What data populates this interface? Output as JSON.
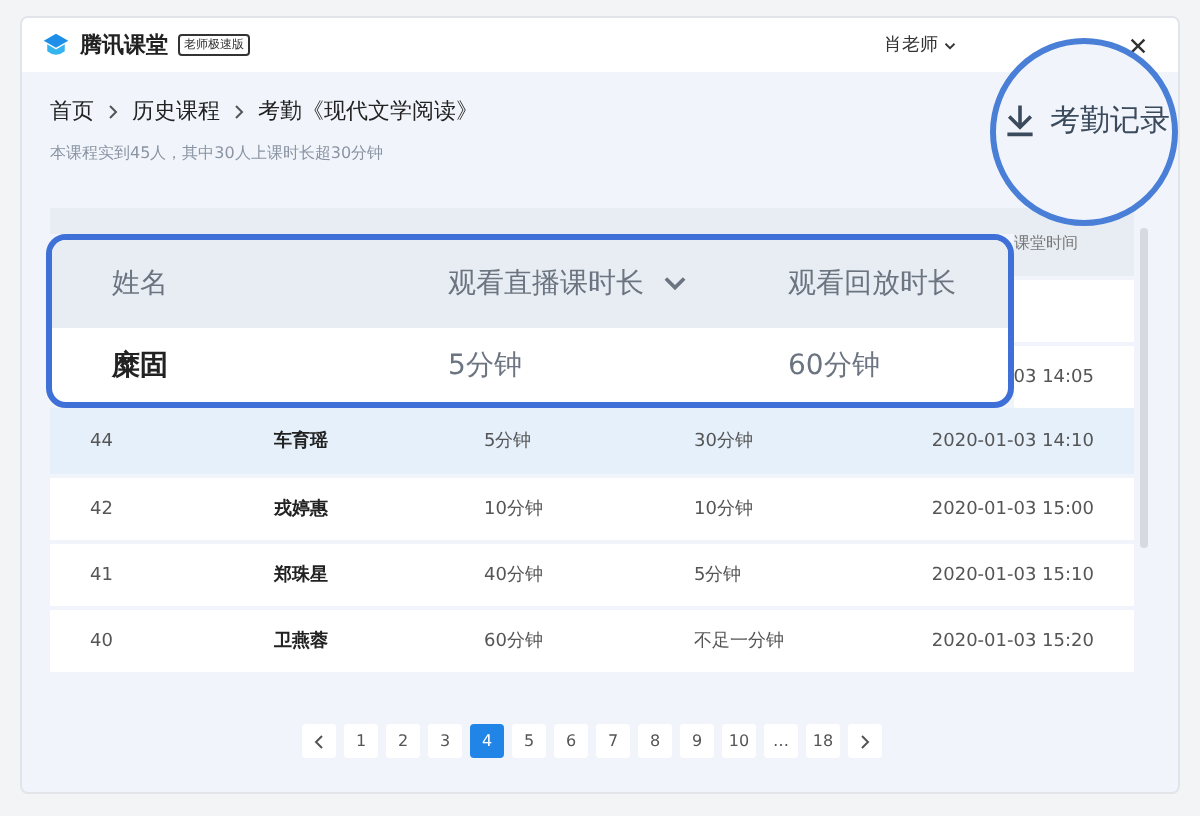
{
  "header": {
    "app_name": "腾讯课堂",
    "badge": "老师极速版",
    "user": "肖老师"
  },
  "breadcrumb": [
    "首页",
    "历史课程",
    "考勤《现代文学阅读》"
  ],
  "summary": "本课程实到45人，其中30人上课时长超30分钟",
  "export_button": {
    "label": "考勤记录"
  },
  "table": {
    "time_header": "课堂时间",
    "partial_time": "03 14:05",
    "rows": [
      {
        "number": "44",
        "name": "车育瑶",
        "live": "5分钟",
        "replay": "30分钟",
        "time": "2020-01-03 14:10",
        "selected": true
      },
      {
        "number": "42",
        "name": "戎婷惠",
        "live": "10分钟",
        "replay": "10分钟",
        "time": "2020-01-03 15:00",
        "selected": false
      },
      {
        "number": "41",
        "name": "郑珠星",
        "live": "40分钟",
        "replay": "5分钟",
        "time": "2020-01-03 15:10",
        "selected": false
      },
      {
        "number": "40",
        "name": "卫燕蓉",
        "live": "60分钟",
        "replay": "不足一分钟",
        "time": "2020-01-03 15:20",
        "selected": false
      }
    ]
  },
  "magnifier": {
    "columns": [
      "姓名",
      "观看直播课时长",
      "观看回放时长"
    ],
    "row": [
      "糜固",
      "5分钟",
      "60分钟"
    ]
  },
  "pagination": {
    "pages": [
      {
        "label": "1",
        "selected": false
      },
      {
        "label": "2",
        "selected": false
      },
      {
        "label": "3",
        "selected": false
      },
      {
        "label": "4",
        "selected": true
      },
      {
        "label": "5",
        "selected": false
      },
      {
        "label": "6",
        "selected": false
      },
      {
        "label": "7",
        "selected": false
      },
      {
        "label": "8",
        "selected": false
      },
      {
        "label": "9",
        "selected": false
      },
      {
        "label": "10",
        "selected": false
      },
      {
        "label": "…",
        "selected": false
      },
      {
        "label": "18",
        "selected": false
      }
    ]
  }
}
